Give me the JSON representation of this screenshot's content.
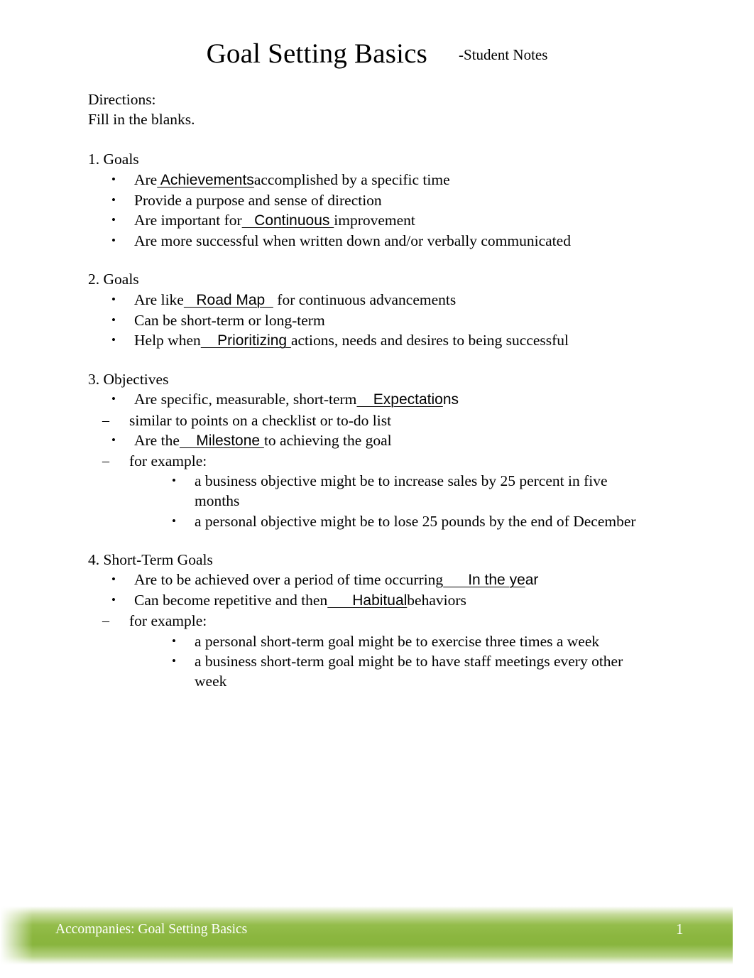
{
  "document": {
    "title": "Goal Setting Basics",
    "subtitle": "-Student Notes",
    "directions_label": "Directions:",
    "directions_text": "Fill in the blanks."
  },
  "sections": [
    {
      "heading": "1. Goals",
      "bullets": [
        {
          "pre": "Are",
          "blank": " Achievements",
          "blank_tail": "",
          "post": "accomplished by a specific time"
        },
        {
          "pre": "Provide a purpose and sense of direction",
          "blank": "",
          "blank_tail": "",
          "post": ""
        },
        {
          "pre": "Are important for",
          "blank": "   Continuous ",
          "blank_tail": "",
          "post": "improvement"
        },
        {
          "pre": "Are more successful when written down and/or verbally communicated",
          "blank": "",
          "blank_tail": "",
          "post": ""
        }
      ]
    },
    {
      "heading": "2. Goals",
      "bullets": [
        {
          "pre": "Are like",
          "blank": "   Road Map  ",
          "blank_tail": "",
          "post": " for continuous advancements"
        },
        {
          "pre": "Can be short-term or long-term",
          "blank": "",
          "blank_tail": "",
          "post": ""
        },
        {
          "pre": "Help when",
          "blank": "    Prioritizing ",
          "blank_tail": "",
          "post": "actions, needs and desires to being successful"
        }
      ]
    },
    {
      "heading": "3. Objectives",
      "bullets": [
        {
          "pre": "Are specific, measurable, short-term",
          "blank": "    Expectatio",
          "blank_tail": "ns",
          "post": ""
        },
        {
          "pre": "Are the",
          "blank": "    Milestone ",
          "blank_tail": "",
          "post": "to achieving the goal"
        }
      ],
      "sub1": "similar to points on a checklist or to-do list",
      "sub2": "for  example:",
      "examples": [
        "a business objective might be to increase sales by 25 percent in five months",
        "a personal objective might be to lose 25 pounds by the end of December"
      ]
    },
    {
      "heading": "4. Short-Term Goals",
      "bullets": [
        {
          "pre": "Are to be achieved over a period of time occurring",
          "blank": "      In the ye",
          "blank_tail": "ar",
          "post": ""
        },
        {
          "pre": "Can become repetitive and then",
          "blank": "      Habitual",
          "blank_tail": "",
          "post": "behaviors"
        }
      ],
      "sub2": "for  example:",
      "examples": [
        "a personal short-term goal might be to exercise three times a week",
        "a business short-term goal might be to have staff meetings every other week"
      ]
    }
  ],
  "bullet_glyphs": {
    "disc": "•",
    "dash": "–"
  },
  "footer": {
    "text": "Accompanies: Goal Setting Basics",
    "page_number": "1",
    "band_color": "#8bb63f"
  }
}
